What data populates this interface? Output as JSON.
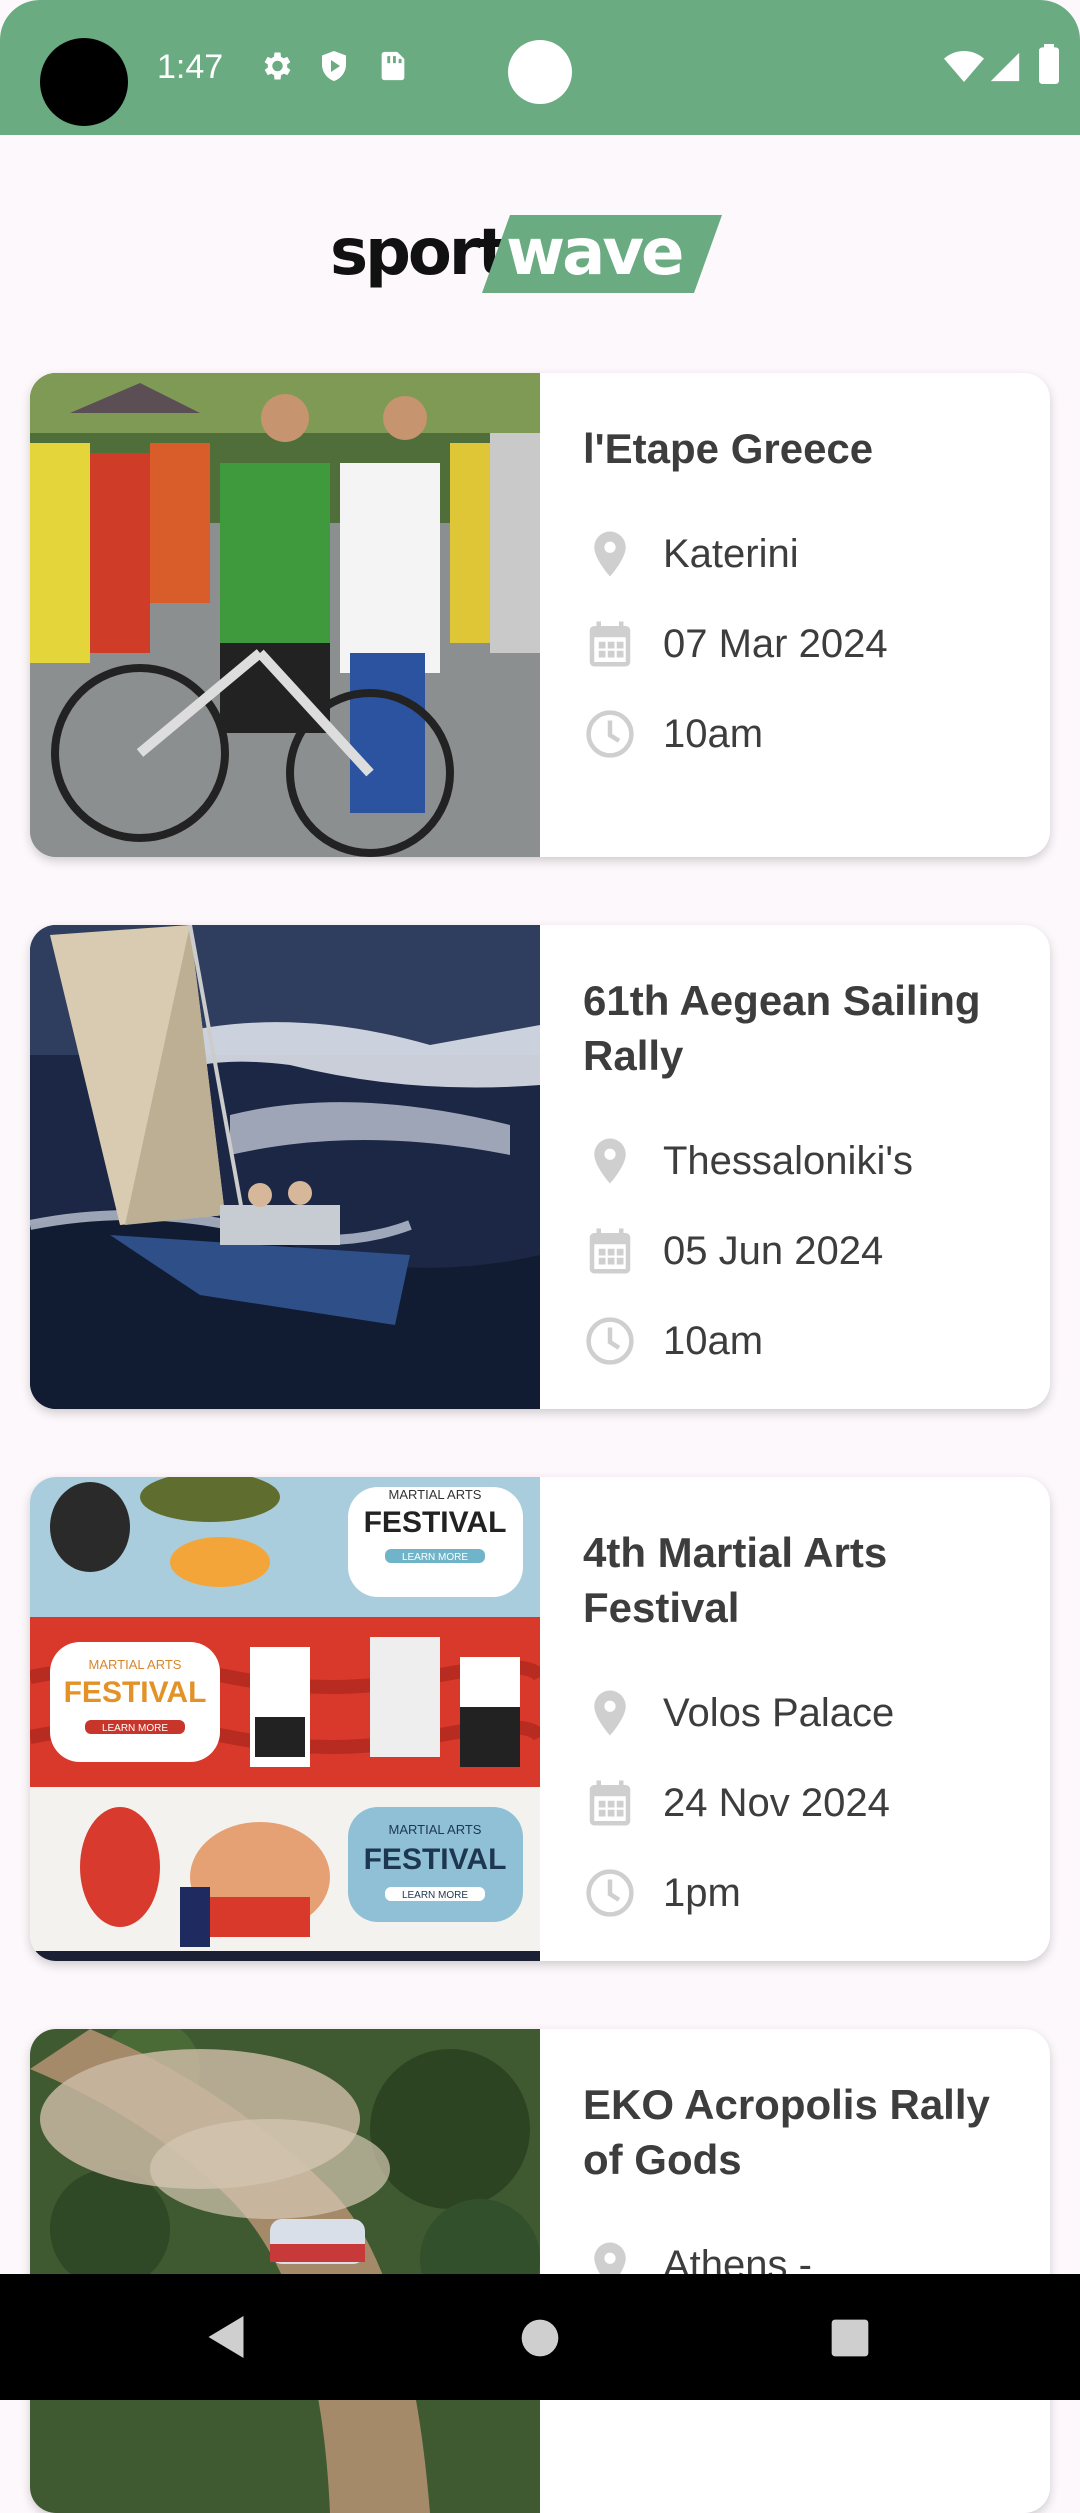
{
  "status_bar": {
    "time": "1:47",
    "icons": [
      "gear-icon",
      "shield-icon",
      "sim-card-icon",
      "wifi-icon",
      "signal-icon",
      "battery-icon"
    ],
    "color": "#6aab82"
  },
  "header": {
    "logo_part1": "sport",
    "logo_part2": "wave",
    "brand_color": "#6aab82"
  },
  "events": [
    {
      "title": "l'Etape Greece",
      "location": "Katerini",
      "date": "07 Mar 2024",
      "time": "10am"
    },
    {
      "title": "61th Aegean Sailing Rally",
      "location": "Thessaloniki's",
      "date": "05 Jun 2024",
      "time": "10am"
    },
    {
      "title": "4th Martial Arts Festival",
      "location": "Volos Palace",
      "date": "24 Nov 2024",
      "time": "1pm",
      "image_text": {
        "label": "MARTIAL ARTS",
        "title": "FESTIVAL",
        "button": "LEARN MORE"
      }
    },
    {
      "title": "EKO Acropolis Rally of Gods",
      "location": "Athens -",
      "date": "",
      "time": ""
    }
  ],
  "nav": {
    "icons": [
      "back-icon",
      "home-icon",
      "recents-icon"
    ]
  }
}
